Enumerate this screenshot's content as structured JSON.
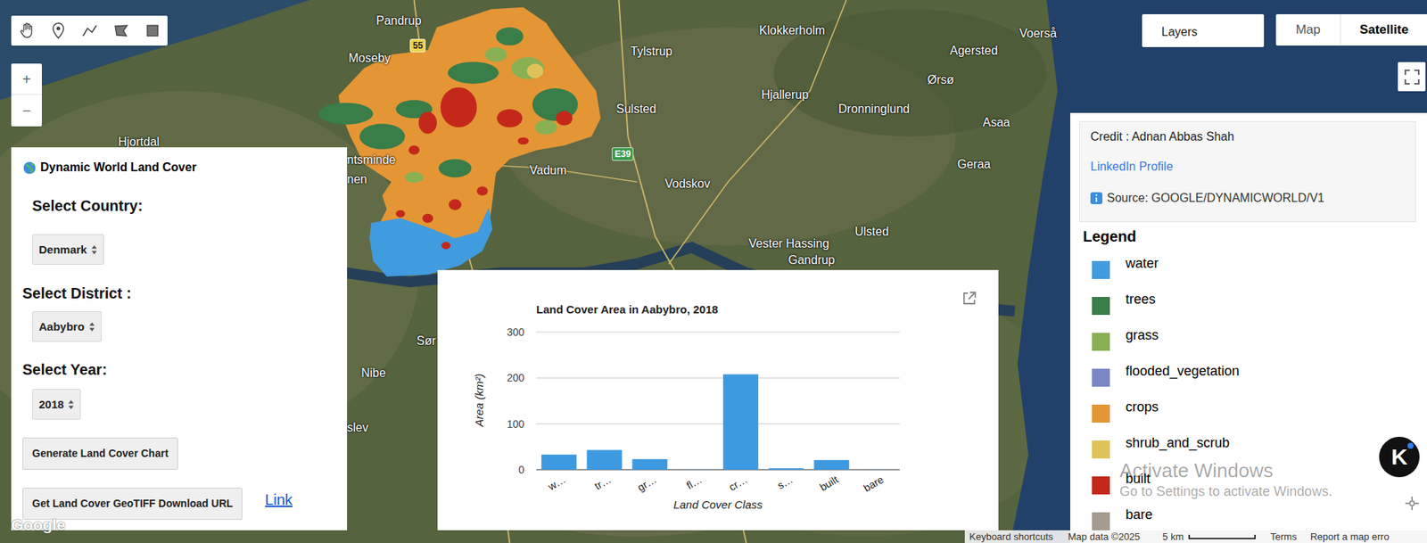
{
  "map": {
    "labels": [
      "Pandrup",
      "Moseby",
      "Tylstrup",
      "Klokkerholm",
      "Agersted",
      "Voerså",
      "Ørsø",
      "Hjallerup",
      "Dronninglund",
      "Asaa",
      "Sulsted",
      "Hjortdal",
      "Vadum",
      "Vodskov",
      "Geraa",
      "Ulsted",
      "Vester Hassing",
      "Gandrup",
      "Nibe",
      "Sør",
      "ntsminde",
      "nen",
      "slev"
    ],
    "road_shields": [
      {
        "label": "55",
        "color": "#f2d24b"
      },
      {
        "label": "E39",
        "color": "#3c9a4c"
      }
    ],
    "logo": "Google"
  },
  "zoom": {
    "in": "+",
    "out": "−"
  },
  "layers_button": "Layers",
  "map_type": [
    {
      "label": "Map",
      "selected": false
    },
    {
      "label": "Satellite",
      "selected": true
    }
  ],
  "control_panel": {
    "title": "Dynamic World Land Cover",
    "fields": [
      {
        "label": "Select Country:",
        "value": "Denmark"
      },
      {
        "label": "Select District :",
        "value": "Aabybro"
      },
      {
        "label": "Select Year:",
        "value": "2018"
      }
    ],
    "buttons": [
      "Generate Land Cover Chart",
      "Get Land Cover GeoTIFF Download URL"
    ],
    "link": "Link"
  },
  "chart": {
    "title": "Land Cover Area in Aabybro, 2018",
    "y_axis": {
      "title": "Area (km²)",
      "ticks": [
        "0",
        "100",
        "200",
        "300"
      ]
    },
    "x_axis": {
      "title": "Land Cover Class",
      "categories": [
        "w…",
        "tr…",
        "gr…",
        "fl…",
        "cr…",
        "s…",
        "built",
        "bare"
      ]
    },
    "values": [
      33,
      43,
      23,
      0.4,
      208,
      3,
      21,
      0.2
    ]
  },
  "info": {
    "credit": "Credit : Adnan Abbas Shah",
    "profile_link": "LinkedIn Profile",
    "source": "Source: GOOGLE/DYNAMICWORLD/V1"
  },
  "legend": {
    "title": "Legend",
    "items": [
      {
        "label": "water",
        "color": "#419bdf"
      },
      {
        "label": "trees",
        "color": "#397d49"
      },
      {
        "label": "grass",
        "color": "#88b053"
      },
      {
        "label": "flooded_vegetation",
        "color": "#7a87c6"
      },
      {
        "label": "crops",
        "color": "#e49635"
      },
      {
        "label": "shrub_and_scrub",
        "color": "#dfc35a"
      },
      {
        "label": "built",
        "color": "#c4281b"
      },
      {
        "label": "bare",
        "color": "#a59b8f"
      }
    ]
  },
  "watermark": {
    "title": "Activate Windows",
    "subtitle": "Go to Settings to activate Windows."
  },
  "badge": "K",
  "footer": {
    "shortcuts": "Keyboard shortcuts",
    "map_data": "Map data ©2025",
    "scale": "5 km",
    "terms": "Terms",
    "report": "Report a map erro"
  }
}
